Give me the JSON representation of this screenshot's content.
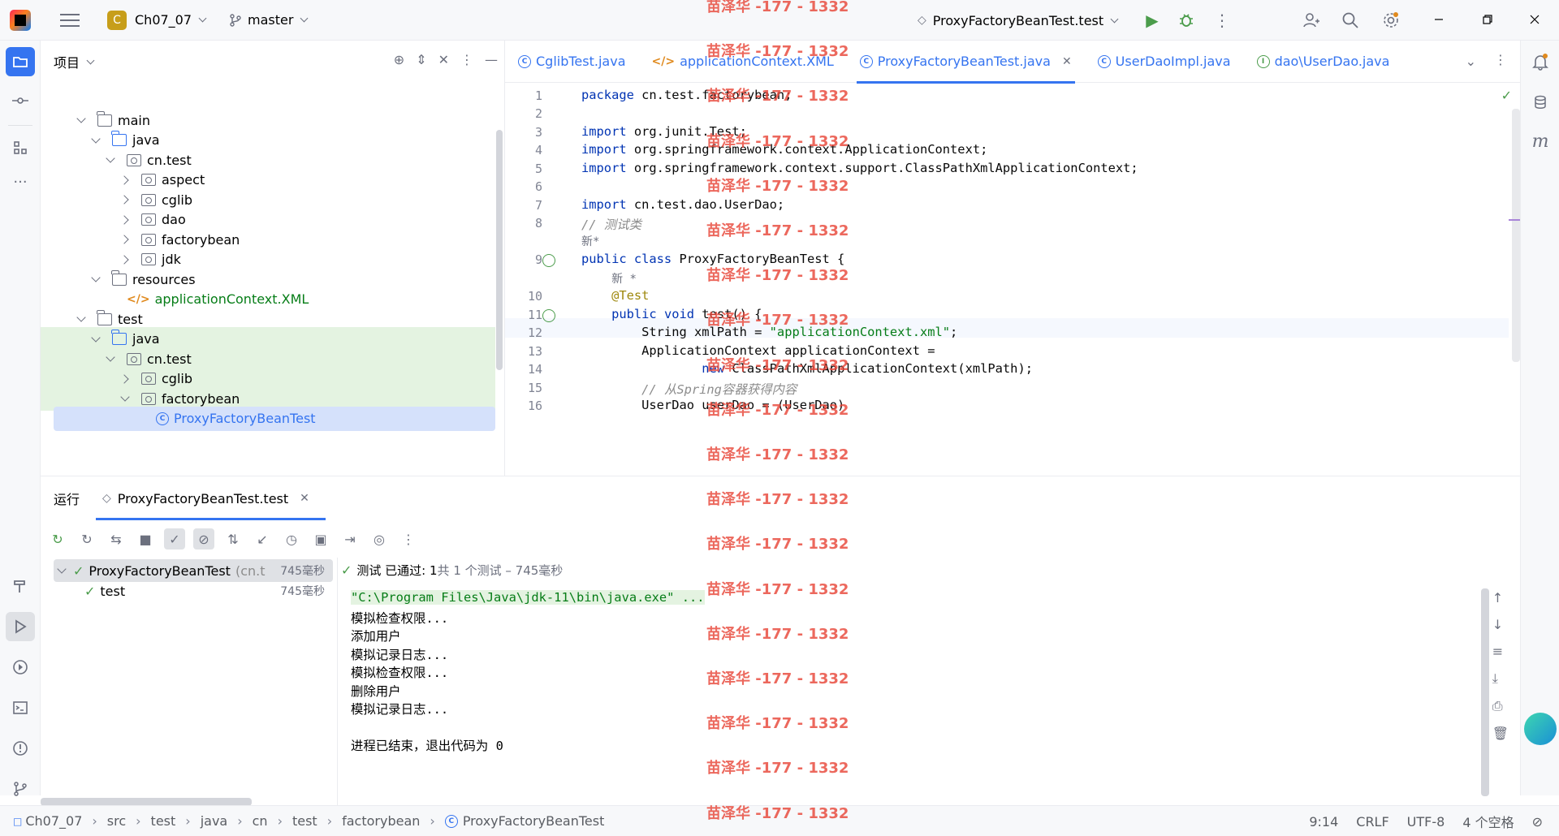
{
  "titlebar": {
    "project_badge": "C",
    "project_name": "Ch07_07",
    "branch": "master",
    "run_config": "ProxyFactoryBeanTest.test"
  },
  "project_panel": {
    "title": "项目",
    "tree": [
      {
        "label": "main",
        "depth": 2,
        "arrow": "d",
        "icon": "folder"
      },
      {
        "label": "java",
        "depth": 3,
        "arrow": "d",
        "icon": "folder-blue"
      },
      {
        "label": "cn.test",
        "depth": 4,
        "arrow": "d",
        "icon": "package"
      },
      {
        "label": "aspect",
        "depth": 5,
        "arrow": "r",
        "icon": "package"
      },
      {
        "label": "cglib",
        "depth": 5,
        "arrow": "r",
        "icon": "package"
      },
      {
        "label": "dao",
        "depth": 5,
        "arrow": "r",
        "icon": "package"
      },
      {
        "label": "factorybean",
        "depth": 5,
        "arrow": "r",
        "icon": "package"
      },
      {
        "label": "jdk",
        "depth": 5,
        "arrow": "r",
        "icon": "package"
      },
      {
        "label": "resources",
        "depth": 3,
        "arrow": "d",
        "icon": "folder"
      },
      {
        "label": "applicationContext.XML",
        "depth": 4,
        "arrow": "n",
        "icon": "xml",
        "color": "#067d17"
      },
      {
        "label": "test",
        "depth": 2,
        "arrow": "d",
        "icon": "folder"
      },
      {
        "label": "java",
        "depth": 3,
        "arrow": "d",
        "icon": "folder-blue",
        "green": true
      },
      {
        "label": "cn.test",
        "depth": 4,
        "arrow": "d",
        "icon": "package",
        "green": true
      },
      {
        "label": "cglib",
        "depth": 5,
        "arrow": "r",
        "icon": "package",
        "green": true
      },
      {
        "label": "factorybean",
        "depth": 5,
        "arrow": "d",
        "icon": "package",
        "green": true
      },
      {
        "label": "ProxyFactoryBeanTest",
        "depth": 6,
        "arrow": "n",
        "icon": "class",
        "green": true,
        "selected": true,
        "color": "#3574f0"
      }
    ]
  },
  "editor": {
    "tabs": [
      {
        "label": "CglibTest.java",
        "icon": "C"
      },
      {
        "label": "applicationContext.XML",
        "icon": "xml"
      },
      {
        "label": "ProxyFactoryBeanTest.java",
        "icon": "C",
        "active": true
      },
      {
        "label": "UserDaoImpl.java",
        "icon": "C"
      },
      {
        "label": "dao\\UserDao.java",
        "icon": "I"
      }
    ],
    "lines": [
      {
        "n": "1",
        "html": "<span class=\"kw\">package</span> cn.test.factorybean;"
      },
      {
        "n": "2",
        "html": ""
      },
      {
        "n": "3",
        "html": "<span class=\"kw\">import</span> org.junit.Test;"
      },
      {
        "n": "4",
        "html": "<span class=\"kw\">import</span> org.springframework.context.ApplicationContext;"
      },
      {
        "n": "5",
        "html": "<span class=\"kw\">import</span> org.springframework.context.support.ClassPathXmlApplicationContext;"
      },
      {
        "n": "6",
        "html": ""
      },
      {
        "n": "7",
        "html": "<span class=\"kw\">import</span> cn.test.dao.UserDao;"
      },
      {
        "n": "8",
        "html": "<span class=\"cmt\">// 测试类</span>"
      },
      {
        "n": "",
        "html": "<span class=\"hint\">新*</span>"
      },
      {
        "n": "9",
        "html": "<span class=\"kw\">public class</span> ProxyFactoryBeanTest {"
      },
      {
        "n": "",
        "html": "    <span class=\"hint\">新 *</span>"
      },
      {
        "n": "10",
        "html": "    <span class=\"ann\">@Test</span>"
      },
      {
        "n": "11",
        "html": "    <span class=\"kw\">public void</span> test() {"
      },
      {
        "n": "12",
        "html": "        String xmlPath = <span class=\"str\">\"applicationContext.xml\"</span>;"
      },
      {
        "n": "13",
        "html": "        ApplicationContext applicationContext ="
      },
      {
        "n": "14",
        "html": "                <span class=\"kw\">new</span> ClassPathXmlApplicationContext(xmlPath);"
      },
      {
        "n": "15",
        "html": "        <span class=\"cmt\">// 从Spring容器获得内容</span>"
      },
      {
        "n": "16",
        "html": "        UserDao userDao = (UserDao)"
      }
    ]
  },
  "run_panel": {
    "title": "运行",
    "tab_label": "ProxyFactoryBeanTest.test",
    "status_pass": "测试 已通过: 1",
    "status_detail": "共 1 个测试 – 745毫秒",
    "tests": [
      {
        "label": "ProxyFactoryBeanTest",
        "sub": "(cn.t",
        "time": "745毫秒"
      },
      {
        "label": "test",
        "sub": "",
        "time": "745毫秒"
      }
    ],
    "console": [
      "\"C:\\Program Files\\Java\\jdk-11\\bin\\java.exe\" ...",
      "模拟检查权限...",
      "添加用户",
      "模拟记录日志...",
      "模拟检查权限...",
      "删除用户",
      "模拟记录日志...",
      "",
      "进程已结束，退出代码为 0"
    ]
  },
  "statusbar": {
    "breadcrumb": [
      "Ch07_07",
      "src",
      "test",
      "java",
      "cn",
      "test",
      "factorybean",
      "ProxyFactoryBeanTest"
    ],
    "position": "9:14",
    "line_sep": "CRLF",
    "encoding": "UTF-8",
    "indent": "4 个空格"
  },
  "watermark": "苗泽华 -177 - 1332"
}
